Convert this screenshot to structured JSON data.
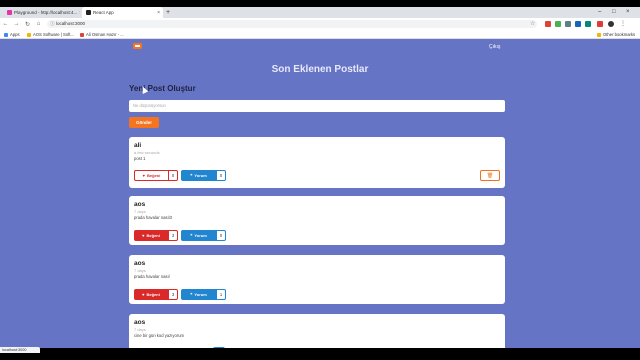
{
  "browser": {
    "tabs": [
      {
        "title": "Playground - http://localhost:4...",
        "active": false,
        "favicon_color": "#e535ab"
      },
      {
        "title": "React App",
        "active": true,
        "favicon_color": "#222222"
      }
    ],
    "url": "localhost:3000",
    "bookmarks": [
      {
        "label": "Apps",
        "icon_color": "#4285f4"
      },
      {
        "label": "AOS Software | Soft...",
        "icon_color": "#f4b400"
      },
      {
        "label": "Ali Osman Hazır - ...",
        "icon_color": "#db4437"
      }
    ],
    "other_bookmarks": "Other bookmarks",
    "status_url": "localhost:3000"
  },
  "header": {
    "exit_label": "Çıkış",
    "page_title": "Son Eklenen Postlar"
  },
  "new_post": {
    "title": "Yeni Post Oluştur",
    "placeholder": "Ne düşünüyorsun",
    "submit_label": "Gönder"
  },
  "posts": [
    {
      "author": "ali",
      "time": "a few seconds",
      "text": "post 1",
      "like_label": "Beğeni",
      "likes": "0",
      "comment_label": "Yorum",
      "comments": "0",
      "liked": false,
      "deletable": true
    },
    {
      "author": "aos",
      "time": "7 days",
      "text": "prada havalar nasıl3",
      "like_label": "Beğeni",
      "likes": "3",
      "comment_label": "Yorum",
      "comments": "0",
      "liked": true,
      "deletable": false
    },
    {
      "author": "aos",
      "time": "7 days",
      "text": "prada havalar nasıl",
      "like_label": "Beğeni",
      "likes": "3",
      "comment_label": "Yorum",
      "comments": "1",
      "liked": true,
      "deletable": false
    },
    {
      "author": "aos",
      "time": "7 days",
      "text": "cine bir gün kod yazıyorum",
      "like_label": "",
      "likes": "",
      "comment_label": "",
      "comments": "",
      "liked": false,
      "deletable": false
    }
  ],
  "colors": {
    "background": "#6574c4",
    "accent_orange": "#f47420",
    "like_red": "#db2828",
    "comment_blue": "#2185d0"
  },
  "icons": [
    "heart-icon",
    "comments-icon",
    "trash-icon",
    "star-icon",
    "back-icon",
    "forward-icon",
    "reload-icon",
    "home-icon"
  ]
}
